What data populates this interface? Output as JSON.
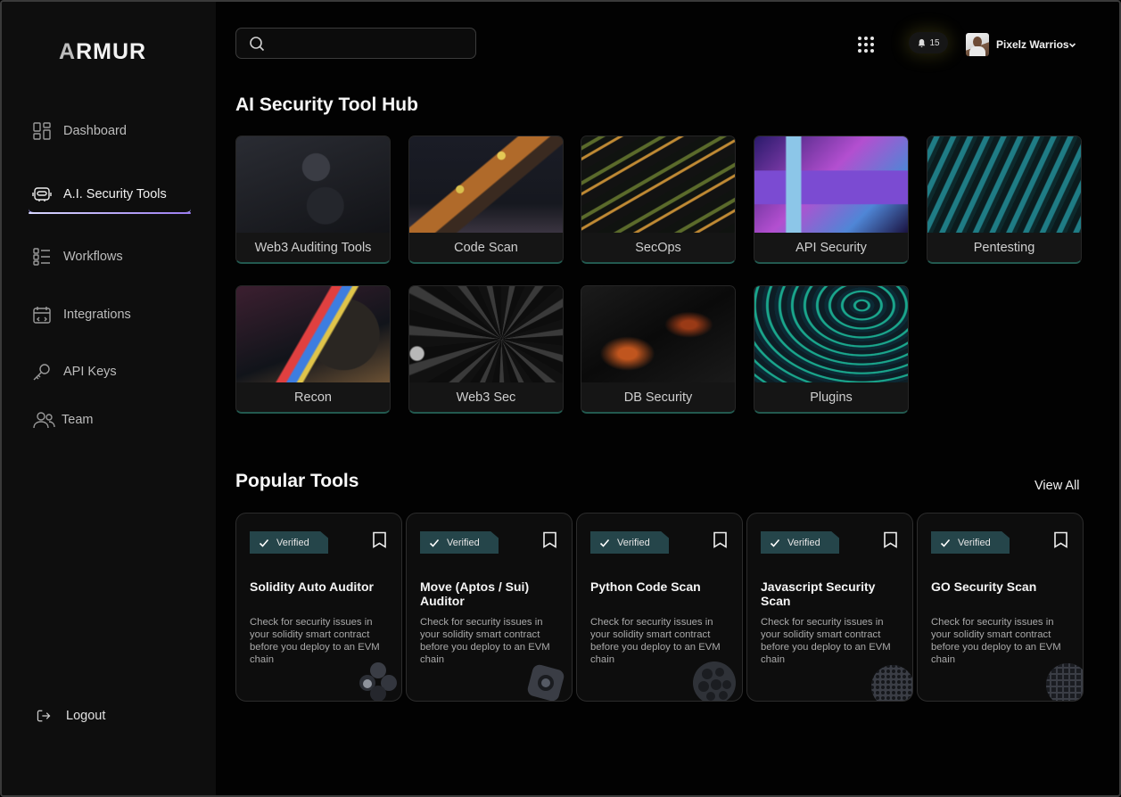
{
  "brand": {
    "logo_a": "A",
    "logo_rest": "RMUR"
  },
  "sidebar": {
    "items": [
      {
        "label": "Dashboard",
        "icon": "dashboard-icon"
      },
      {
        "label": "A.I. Security Tools",
        "icon": "robot-icon",
        "active": true
      },
      {
        "label": "Workflows",
        "icon": "workflows-icon"
      },
      {
        "label": "Integrations",
        "icon": "integrations-icon"
      },
      {
        "label": "API Keys",
        "icon": "key-icon"
      },
      {
        "label": "Team",
        "icon": "team-icon"
      }
    ],
    "logout": {
      "label": "Logout",
      "icon": "logout-icon"
    }
  },
  "topbar": {
    "search": {
      "placeholder": "",
      "value": ""
    },
    "notifications": {
      "count": "15"
    },
    "user": {
      "name": "Pixelz Warrios"
    }
  },
  "hub": {
    "title": "AI Security Tool Hub",
    "tiles": [
      {
        "label": "Web3 Auditing Tools"
      },
      {
        "label": "Code Scan"
      },
      {
        "label": "SecOps"
      },
      {
        "label": "API Security"
      },
      {
        "label": "Pentesting"
      },
      {
        "label": "Recon"
      },
      {
        "label": "Web3 Sec"
      },
      {
        "label": "DB Security"
      },
      {
        "label": "Plugins"
      }
    ]
  },
  "popular": {
    "title": "Popular Tools",
    "view_all": "View All",
    "cards": [
      {
        "badge": "Verified",
        "title": "Solidity Auto Auditor",
        "desc": "Check for security issues in your solidity smart contract before you deploy to an EVM chain"
      },
      {
        "badge": "Verified",
        "title": "Move (Aptos / Sui) Auditor",
        "desc": "Check for security issues in your solidity smart contract before you deploy to an EVM chain"
      },
      {
        "badge": "Verified",
        "title": "Python Code Scan",
        "desc": "Check for security issues in your solidity smart contract before you deploy to an EVM chain"
      },
      {
        "badge": "Verified",
        "title": "Javascript Security Scan",
        "desc": "Check for security issues in your solidity smart contract before you deploy to an EVM chain"
      },
      {
        "badge": "Verified",
        "title": "GO Security Scan",
        "desc": "Check for security issues in your solidity smart contract before you deploy to an EVM chain"
      }
    ]
  },
  "colors": {
    "accent": "#a9a3ff",
    "tile_border": "#22594f",
    "badge": "#25454a"
  }
}
